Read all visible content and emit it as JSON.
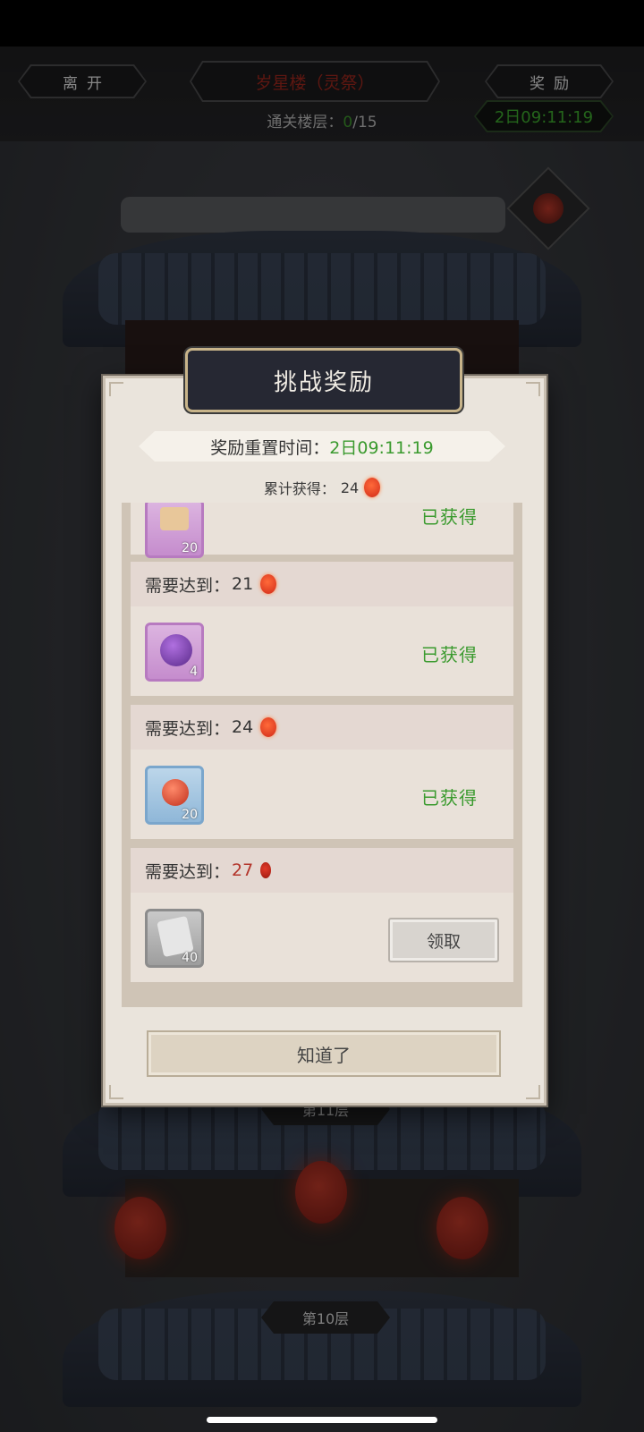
{
  "top_bar": {
    "leave_label": "离开",
    "tower_title": "岁星楼（灵祭）",
    "rewards_label": "奖励",
    "cleared_floors_label": "通关楼层：",
    "cleared_floors_value": "0",
    "cleared_floors_total": "/15",
    "timer": "2日09:11:19"
  },
  "floors": {
    "floor_11": "第11层",
    "floor_10": "第10层"
  },
  "dialog": {
    "title": "挑战奖励",
    "reset_label": "奖励重置时间：",
    "reset_value": "2日09:11:19",
    "total_label": "累计获得：",
    "total_value": "24",
    "rewards": [
      {
        "requirement_label": "",
        "requirement_value": "",
        "item_count": "20",
        "status": "已获得",
        "item_icon": "scroll-icon"
      },
      {
        "requirement_label": "需要达到：",
        "requirement_value": "21",
        "item_count": "4",
        "status": "已获得",
        "item_icon": "purple-orb-icon"
      },
      {
        "requirement_label": "需要达到：",
        "requirement_value": "24",
        "item_count": "20",
        "status": "已获得",
        "item_icon": "red-orb-icon"
      },
      {
        "requirement_label": "需要达到：",
        "requirement_value": "27",
        "item_count": "40",
        "status": "领取",
        "item_icon": "scroll-icon"
      }
    ],
    "ok_label": "知道了"
  },
  "colors": {
    "obtained_green": "#3a9a2e",
    "locked_red": "#b3342a",
    "timer_green": "#3fae2f",
    "title_red": "#a3281e"
  }
}
